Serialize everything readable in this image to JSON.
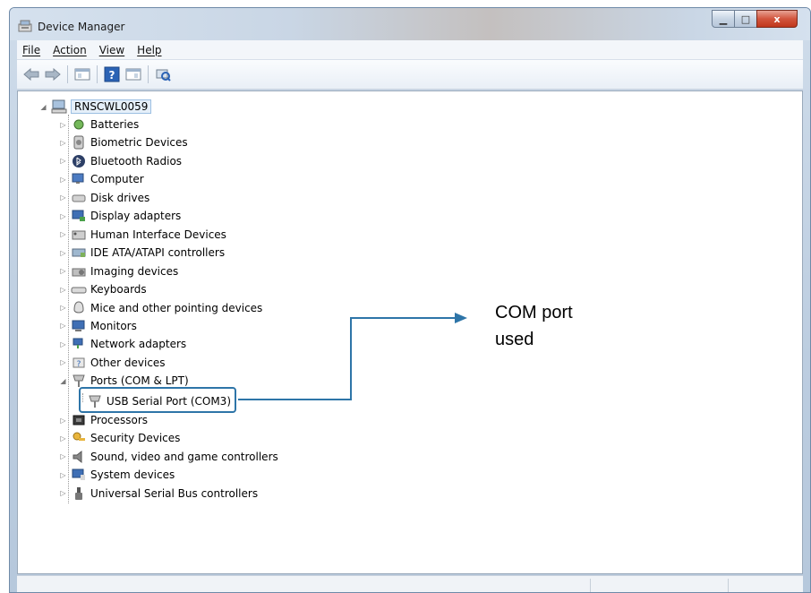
{
  "window": {
    "title": "Device Manager",
    "caption_buttons": {
      "minimize": "▁",
      "maximize": "□",
      "close": "x"
    }
  },
  "menu": [
    "File",
    "Action",
    "View",
    "Help"
  ],
  "toolbar": {
    "icons": [
      "back-arrow-icon",
      "forward-arrow-icon",
      "show-hide-tree-icon",
      "help-icon",
      "properties-icon",
      "scan-hardware-icon"
    ]
  },
  "tree": {
    "root": "RNSCWL0059",
    "categories": [
      "Batteries",
      "Biometric Devices",
      "Bluetooth Radios",
      "Computer",
      "Disk drives",
      "Display adapters",
      "Human Interface Devices",
      "IDE ATA/ATAPI controllers",
      "Imaging devices",
      "Keyboards",
      "Mice and other pointing devices",
      "Monitors",
      "Network adapters",
      "Other devices",
      "Ports (COM & LPT)",
      "Processors",
      "Security Devices",
      "Sound, video and game controllers",
      "System devices",
      "Universal Serial Bus controllers"
    ],
    "expanded_child": "USB Serial Port (COM3)"
  },
  "annotation": {
    "line1": "COM port",
    "line2": "used",
    "color": "#2e75a8"
  }
}
